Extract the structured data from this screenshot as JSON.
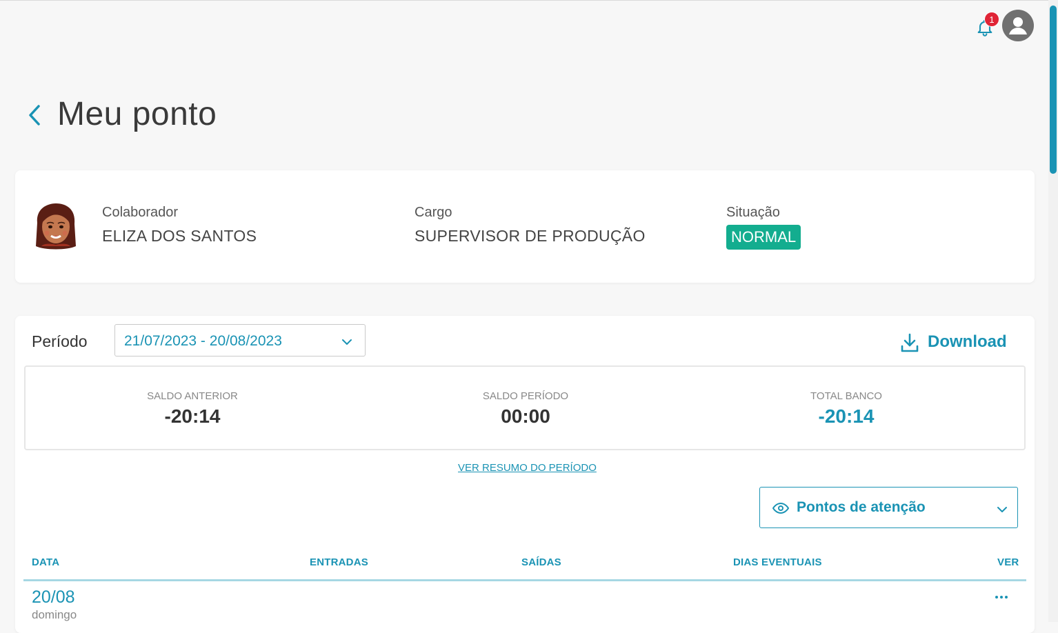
{
  "header": {
    "notifications_count": "1"
  },
  "page": {
    "title": "Meu ponto"
  },
  "employee": {
    "collaborator_label": "Colaborador",
    "collaborator_name": "ELIZA DOS SANTOS",
    "role_label": "Cargo",
    "role_value": "SUPERVISOR DE PRODUÇÃO",
    "status_label": "Situação",
    "status_value": "NORMAL"
  },
  "period": {
    "label": "Período",
    "selected": "21/07/2023 - 20/08/2023",
    "download_label": "Download"
  },
  "summary": {
    "saldo_anterior_label": "SALDO ANTERIOR",
    "saldo_anterior_value": "-20:14",
    "saldo_periodo_label": "SALDO PERÍODO",
    "saldo_periodo_value": "00:00",
    "total_banco_label": "TOTAL BANCO",
    "total_banco_value": "-20:14",
    "resumo_link": "VER RESUMO DO PERÍODO"
  },
  "filter": {
    "attention_label": "Pontos de atenção"
  },
  "table": {
    "columns": [
      "DATA",
      "ENTRADAS",
      "SAÍDAS",
      "DIAS EVENTUAIS",
      "VER"
    ],
    "rows": [
      {
        "date": "20/08",
        "weekday": "domingo"
      }
    ]
  },
  "colors": {
    "accent": "#1a93b4",
    "status_normal": "#13ad8f",
    "badge": "#e02436"
  }
}
